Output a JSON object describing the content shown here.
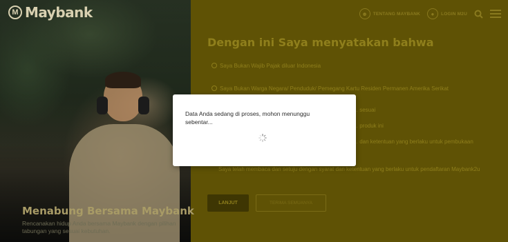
{
  "brand": {
    "name": "Maybank"
  },
  "hero": {
    "title": "Menabung Bersama Maybank",
    "subtitle": "Rencanakan hidup Anda bersama Maybank dengan pilihan tabungan yang sesuai kebutuhan."
  },
  "nav": {
    "about_label": "TENTANG MAYBANK",
    "login_label": "LOGIN M2U",
    "search_icon": "search-icon",
    "menu_icon": "hamburger-menu-icon"
  },
  "declaration": {
    "title": "Dengan ini Saya menyatakan bahwa",
    "options": [
      "Saya Bukan Wajib Pajak diluar Indonesia",
      "Saya Bukan Warga Negara/ Penduduk/ Pemegang Kartu Residen Permanen Amerika Serikat",
      "… sesuai",
      "… produk ini",
      "… dan ketentuan yang berlaku untuk pembukaan",
      "Saya telah membaca dan setuju dengan syarat dan ketentuan yang berlaku untuk pendaftaran Maybank2u"
    ],
    "continue_label": "LANJUT",
    "accept_all_label": "TERIMA SEMUANYA"
  },
  "modal": {
    "message": "Data Anda sedang di proses, mohon menunggu sebentar...",
    "spinner_icon": "loading-spinner-icon"
  },
  "colors": {
    "overlay_panel": "#5f5205",
    "modal_bg": "#ffffff"
  }
}
